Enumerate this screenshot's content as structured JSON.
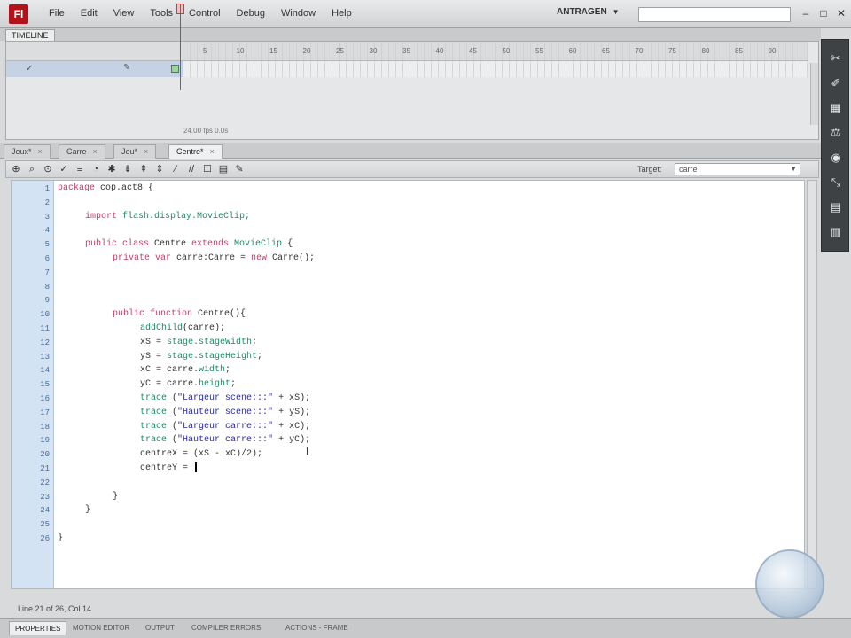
{
  "menubar": {
    "logo": "Fl",
    "items": [
      "File",
      "Edit",
      "View",
      "Tools",
      "Control",
      "Debug",
      "Window",
      "Help"
    ],
    "workspace": "ANTRAGEN",
    "search_placeholder": ""
  },
  "timeline": {
    "tab_label": "TIMELINE",
    "frame_numbers": [
      "5",
      "10",
      "15",
      "20",
      "25",
      "30",
      "35",
      "40",
      "45",
      "50",
      "55",
      "60",
      "65",
      "70",
      "75",
      "80",
      "85",
      "90"
    ],
    "footer": "24.00 fps   0.0s"
  },
  "doc_tabs": [
    {
      "label": "Jeux*",
      "active": false
    },
    {
      "label": "Carre",
      "active": false
    },
    {
      "label": "Jeu*",
      "active": false
    },
    {
      "label": "Centre*",
      "active": true
    }
  ],
  "actions_toolbar": {
    "target_label": "Target:",
    "target_value": "carre"
  },
  "code": {
    "line_numbers": [
      "1",
      "2",
      "3",
      "4",
      "5",
      "6",
      "7",
      "8",
      "9",
      "10",
      "11",
      "12",
      "13",
      "14",
      "15",
      "16",
      "17",
      "18",
      "19",
      "20",
      "21",
      "22",
      "23",
      "24",
      "25",
      "26"
    ],
    "lines": [
      {
        "indent": 0,
        "parts": [
          {
            "c": "kw2",
            "t": "package"
          },
          {
            "c": "tk",
            "t": " cop.act8 {"
          }
        ]
      },
      {
        "indent": 0,
        "parts": []
      },
      {
        "indent": 1,
        "parts": [
          {
            "c": "kw2",
            "t": "import"
          },
          {
            "c": "fn",
            "t": " flash.display.MovieClip;"
          }
        ]
      },
      {
        "indent": 0,
        "parts": []
      },
      {
        "indent": 1,
        "parts": [
          {
            "c": "kw2",
            "t": "public class"
          },
          {
            "c": "tk",
            "t": " Centre "
          },
          {
            "c": "kw2",
            "t": "extends"
          },
          {
            "c": "fn",
            "t": " MovieClip"
          },
          {
            "c": "tk",
            "t": " {"
          }
        ]
      },
      {
        "indent": 2,
        "parts": [
          {
            "c": "kw2",
            "t": "private var"
          },
          {
            "c": "tk",
            "t": " carre:Carre = "
          },
          {
            "c": "kw2",
            "t": "new"
          },
          {
            "c": "tk",
            "t": " Carre();"
          }
        ]
      },
      {
        "indent": 0,
        "parts": []
      },
      {
        "indent": 0,
        "parts": []
      },
      {
        "indent": 0,
        "parts": []
      },
      {
        "indent": 2,
        "parts": [
          {
            "c": "kw2",
            "t": "public function"
          },
          {
            "c": "tk",
            "t": " Centre(){"
          }
        ]
      },
      {
        "indent": 3,
        "parts": [
          {
            "c": "fn",
            "t": "addChild"
          },
          {
            "c": "tk",
            "t": "(carre);"
          }
        ]
      },
      {
        "indent": 3,
        "parts": [
          {
            "c": "tk",
            "t": "xS = "
          },
          {
            "c": "fn",
            "t": "stage.stageWidth"
          },
          {
            "c": "tk",
            "t": ";"
          }
        ]
      },
      {
        "indent": 3,
        "parts": [
          {
            "c": "tk",
            "t": "yS = "
          },
          {
            "c": "fn",
            "t": "stage.stageHeight"
          },
          {
            "c": "tk",
            "t": ";"
          }
        ]
      },
      {
        "indent": 3,
        "parts": [
          {
            "c": "tk",
            "t": "xC = carre."
          },
          {
            "c": "fn",
            "t": "width"
          },
          {
            "c": "tk",
            "t": ";"
          }
        ]
      },
      {
        "indent": 3,
        "parts": [
          {
            "c": "tk",
            "t": "yC = carre."
          },
          {
            "c": "fn",
            "t": "height"
          },
          {
            "c": "tk",
            "t": ";"
          }
        ]
      },
      {
        "indent": 3,
        "parts": [
          {
            "c": "fn",
            "t": "trace"
          },
          {
            "c": "tk",
            "t": " ("
          },
          {
            "c": "str",
            "t": "\"Largeur scene:::\""
          },
          {
            "c": "tk",
            "t": " + xS);"
          }
        ]
      },
      {
        "indent": 3,
        "parts": [
          {
            "c": "fn",
            "t": "trace"
          },
          {
            "c": "tk",
            "t": " ("
          },
          {
            "c": "str",
            "t": "\"Hauteur scene:::\""
          },
          {
            "c": "tk",
            "t": " + yS);"
          }
        ]
      },
      {
        "indent": 3,
        "parts": [
          {
            "c": "fn",
            "t": "trace"
          },
          {
            "c": "tk",
            "t": " ("
          },
          {
            "c": "str",
            "t": "\"Largeur carre:::\""
          },
          {
            "c": "tk",
            "t": " + xC);"
          }
        ]
      },
      {
        "indent": 3,
        "parts": [
          {
            "c": "fn",
            "t": "trace"
          },
          {
            "c": "tk",
            "t": " ("
          },
          {
            "c": "str",
            "t": "\"Hauteur carre:::\""
          },
          {
            "c": "tk",
            "t": " + yC);"
          }
        ]
      },
      {
        "indent": 3,
        "parts": [
          {
            "c": "tk",
            "t": "centreX = (xS - xC)/2);"
          }
        ]
      },
      {
        "indent": 3,
        "parts": [
          {
            "c": "tk",
            "t": "centreY = "
          }
        ],
        "caret": true
      },
      {
        "indent": 0,
        "parts": []
      },
      {
        "indent": 2,
        "parts": [
          {
            "c": "tk",
            "t": "}"
          }
        ]
      },
      {
        "indent": 1,
        "parts": [
          {
            "c": "tk",
            "t": "}"
          }
        ]
      },
      {
        "indent": 0,
        "parts": []
      },
      {
        "indent": 0,
        "parts": [
          {
            "c": "tk",
            "t": "}"
          }
        ]
      }
    ]
  },
  "status": "Line 21 of 26, Col 14",
  "bottom_tabs": [
    {
      "label": "PROPERTIES",
      "active": true
    },
    {
      "label": "MOTION EDITOR",
      "active": false
    },
    {
      "label": "OUTPUT",
      "active": false
    },
    {
      "label": "COMPILER ERRORS",
      "active": false
    },
    {
      "label": "ACTIONS - FRAME",
      "active": false
    }
  ],
  "tools": [
    "scissors-icon",
    "brush-icon",
    "panel-icon",
    "align-icon",
    "color-icon",
    "transform-icon",
    "library-icon",
    "chart-icon"
  ]
}
